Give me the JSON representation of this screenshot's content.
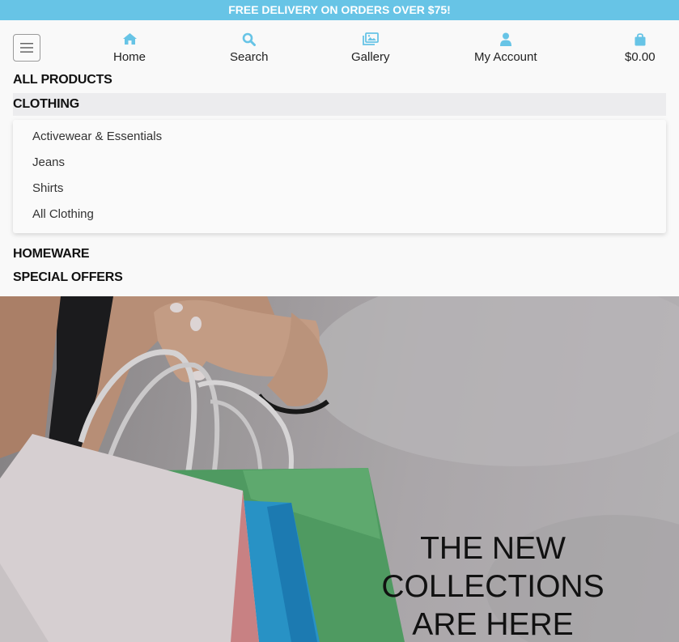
{
  "promo": {
    "text": "FREE DELIVERY ON ORDERS OVER $75!"
  },
  "colors": {
    "accent": "#67c4e6",
    "text": "#111111",
    "active_bg": "#ececee"
  },
  "nav": {
    "menu_icon": "hamburger-icon",
    "items": [
      {
        "label": "Home",
        "icon": "home-icon"
      },
      {
        "label": "Search",
        "icon": "search-icon"
      },
      {
        "label": "Gallery",
        "icon": "image-icon"
      },
      {
        "label": "My Account",
        "icon": "user-icon"
      },
      {
        "label": "$0.00",
        "icon": "shopping-bag-icon"
      }
    ]
  },
  "menu": {
    "all_products": "ALL PRODUCTS",
    "clothing": "CLOTHING",
    "clothing_dropdown": [
      "Activewear & Essentials",
      "Jeans",
      "Shirts",
      "All Clothing"
    ],
    "homeware": "HOMEWARE",
    "special_offers": "SPECIAL OFFERS"
  },
  "hero": {
    "headline": "THE NEW COLLECTIONS ARE HERE",
    "image": "woman-holding-shopping-bags"
  }
}
